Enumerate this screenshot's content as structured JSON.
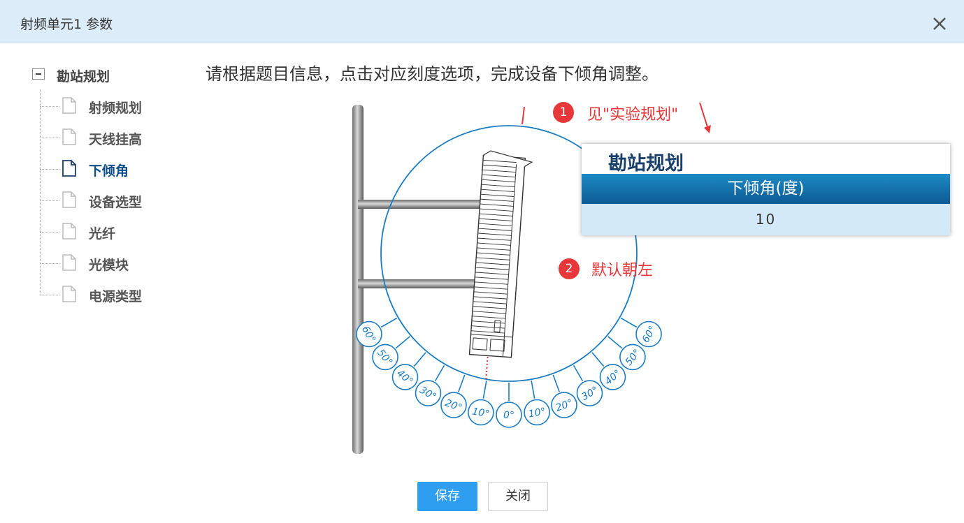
{
  "window": {
    "title": "射频单元1 参数"
  },
  "tree": {
    "root_label": "勘站规划",
    "items": [
      {
        "label": "射频规划"
      },
      {
        "label": "天线挂高"
      },
      {
        "label": "下倾角"
      },
      {
        "label": "设备选型"
      },
      {
        "label": "光纤"
      },
      {
        "label": "光模块"
      },
      {
        "label": "电源类型"
      }
    ],
    "active_index": 2
  },
  "main": {
    "instruction": "请根据题目信息，点击对应刻度选项，完成设备下倾角调整。",
    "note1": {
      "number": "1",
      "text": "见\"实验规划\""
    },
    "note2": {
      "number": "2",
      "text": "默认朝左"
    },
    "callout": {
      "title": "勘站规划",
      "header": "下倾角(度)",
      "value": "10"
    },
    "angle_labels_left": [
      "60°",
      "50°",
      "40°",
      "30°",
      "20°",
      "10°"
    ],
    "center_label": "0°",
    "angle_labels_right": [
      "10°",
      "20°",
      "30°",
      "40°",
      "50°",
      "60°"
    ]
  },
  "buttons": {
    "save": "保存",
    "close": "关闭"
  },
  "colors": {
    "titlebar_bg": "#dcecf8",
    "accent_blue": "#2d9ef0",
    "circle_blue": "#1a7dc4",
    "annotation_red": "#e8373a",
    "table_header": "#0c5a93"
  }
}
